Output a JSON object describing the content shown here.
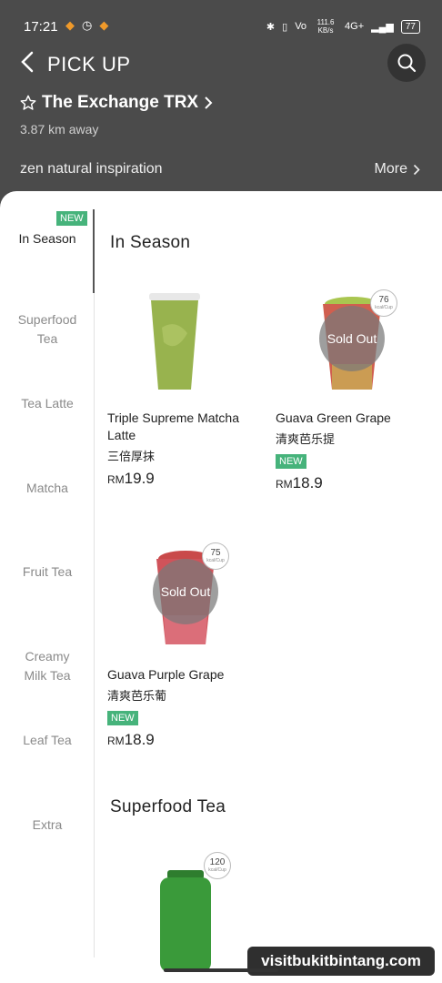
{
  "status_bar": {
    "time": "17:21",
    "speed": "111.6 KB/s",
    "network": "4G+",
    "battery": "77"
  },
  "header": {
    "title": "PICK UP",
    "store_name": "The Exchange TRX",
    "distance": "3.87 km away",
    "brand": "zen natural inspiration",
    "more_label": "More"
  },
  "sidebar": {
    "items": [
      {
        "label": "In Season",
        "badge": "NEW"
      },
      {
        "label": "Superfood Tea"
      },
      {
        "label": "Tea Latte"
      },
      {
        "label": "Matcha"
      },
      {
        "label": "Fruit Tea"
      },
      {
        "label": "Creamy Milk Tea"
      },
      {
        "label": "Leaf Tea"
      },
      {
        "label": "Extra"
      }
    ]
  },
  "sections": [
    {
      "title": "In Season",
      "products": [
        {
          "name": "Triple Supreme Matcha Latte",
          "name_cn": "三倍厚抹",
          "currency": "RM",
          "price": "19.9",
          "drink_color": "#98b34e"
        },
        {
          "name": "Guava Green Grape",
          "name_cn": "清爽芭乐提",
          "badge": "NEW",
          "currency": "RM",
          "price": "18.9",
          "sold_out": "Sold Out",
          "kcal": "76",
          "kcal_unit": "kcal/Cup",
          "drink_color": "#d05f4f"
        },
        {
          "name": "Guava Purple Grape",
          "name_cn": "清爽芭乐葡",
          "badge": "NEW",
          "currency": "RM",
          "price": "18.9",
          "sold_out": "Sold Out",
          "kcal": "75",
          "kcal_unit": "kcal/Cup",
          "drink_color": "#d0535a"
        }
      ]
    },
    {
      "title": "Superfood Tea",
      "products": [
        {
          "kcal": "120",
          "kcal_unit": "kcal/Cup",
          "drink_color": "#3a9a3a"
        }
      ]
    }
  ],
  "watermark": "visitbukitbintang.com"
}
